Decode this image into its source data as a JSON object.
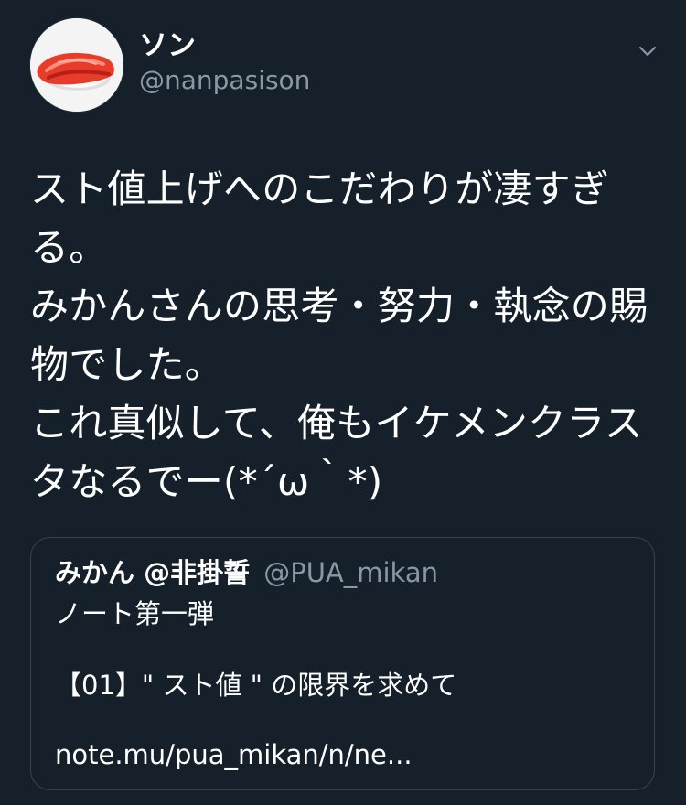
{
  "colors": {
    "background": "#15202b",
    "text_primary": "#ffffff",
    "text_secondary": "#8899a6",
    "border": "#38444d"
  },
  "author": {
    "display_name": "ソン",
    "handle": "@nanpasison",
    "avatar": "sushi-avatar"
  },
  "menu": {
    "icon": "chevron-down-icon"
  },
  "tweet": {
    "text": "スト値上げへのこだわりが凄すぎる。\nみかんさんの思考・努力・執念の賜物でした。\nこれ真似して、俺もイケメンクラスタなるでー(*´ω｀*)"
  },
  "quote": {
    "display_name": "みかん @非掛誓",
    "handle": "@PUA_mikan",
    "line1": "ノート第一弾",
    "title": "【01】\" スト値 \" の限界を求めて",
    "link": "note.mu/pua_mikan/n/ne..."
  }
}
